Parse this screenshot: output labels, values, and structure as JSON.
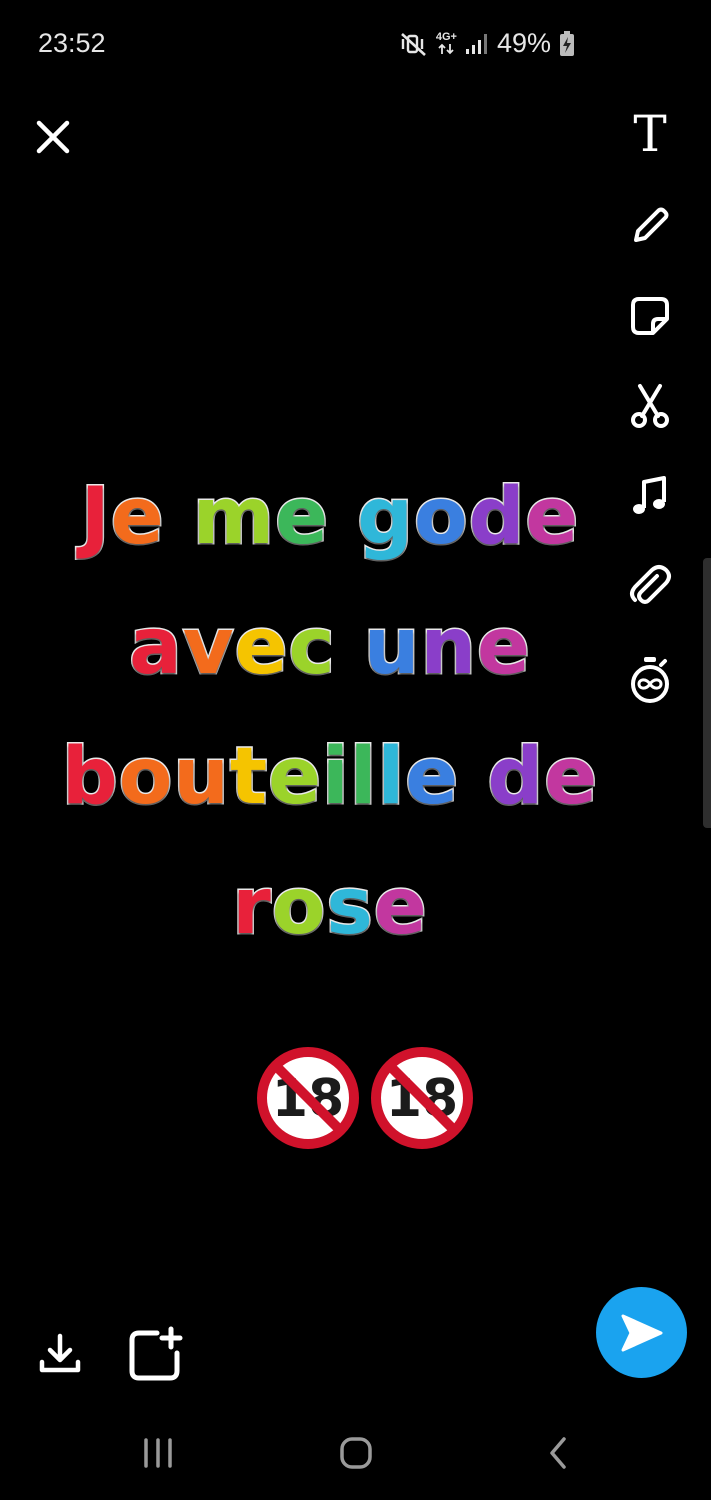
{
  "status_bar": {
    "time": "23:52",
    "network_top": "4G+",
    "battery_percent": "49%",
    "icons": [
      "mute-vibrate-icon",
      "network-arrows-icon",
      "signal-icon",
      "battery-charging-icon"
    ]
  },
  "toolbar": {
    "close_icon": "close-icon",
    "tools": [
      {
        "name": "text-tool",
        "icon": "text-icon",
        "glyph": "T"
      },
      {
        "name": "draw-tool",
        "icon": "pencil-icon"
      },
      {
        "name": "sticker-tool",
        "icon": "sticker-icon"
      },
      {
        "name": "scissors-tool",
        "icon": "scissors-icon"
      },
      {
        "name": "music-tool",
        "icon": "music-note-icon"
      },
      {
        "name": "attach-link-tool",
        "icon": "paperclip-icon"
      },
      {
        "name": "timer-tool",
        "icon": "timer-infinity-icon"
      }
    ]
  },
  "caption": {
    "lines": [
      "Je me gode",
      "avec une",
      "bouteille de",
      "rose"
    ]
  },
  "emojis": [
    {
      "icon": "no-one-under-eighteen-icon",
      "label": "18"
    },
    {
      "icon": "no-one-under-eighteen-icon",
      "label": "18"
    }
  ],
  "bottom_actions": {
    "download_icon": "download-icon",
    "story_icon": "add-to-story-icon",
    "send_icon": "send-arrow-icon",
    "send_color": "#1aa3ef"
  },
  "nav_bar": {
    "recents_icon": "recents-icon",
    "home_icon": "home-icon",
    "back_icon": "back-icon"
  },
  "colors": {
    "background": "#000000",
    "send_button": "#1aa3ef",
    "rainbow": [
      "#e8213a",
      "#f36b1c",
      "#f5c400",
      "#9bd32a",
      "#3cb75a",
      "#2fb7d9",
      "#3a7fe0",
      "#8a3ec9",
      "#c2379f"
    ]
  }
}
